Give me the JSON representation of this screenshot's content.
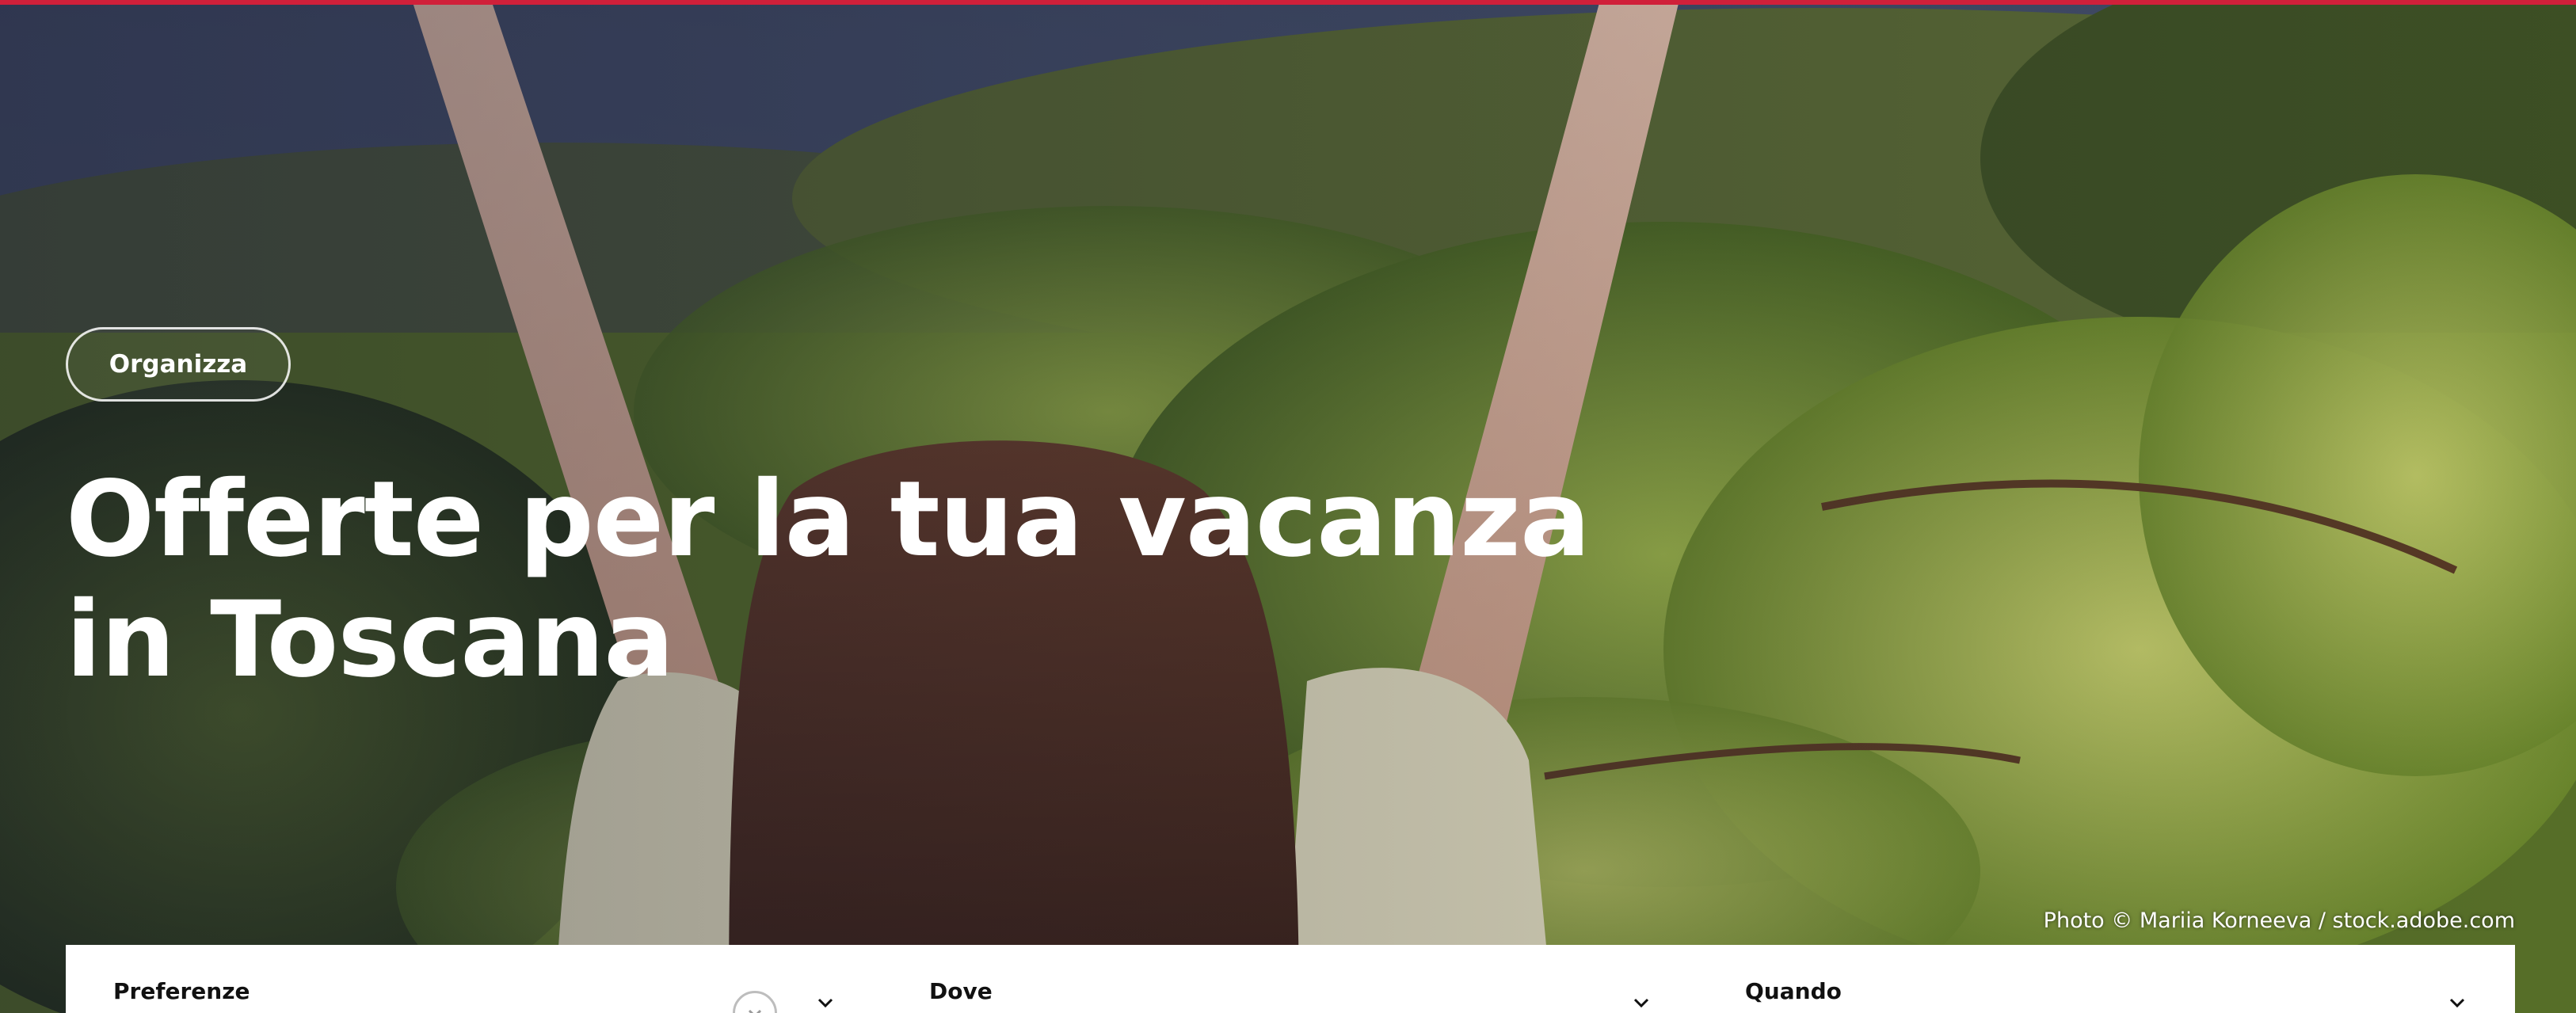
{
  "hero": {
    "tag_label": "Organizza",
    "title_line_1": "Offerte per la tua vacanza",
    "title_line_2": "in Toscana",
    "photo_credit": "Photo © Mariia Korneeva / stock.adobe.com",
    "accent_color": "#d0203a"
  },
  "search": {
    "fields": [
      {
        "label": "Preferenze",
        "icon": "chevron-down-icon"
      },
      {
        "label": "Dove",
        "icon": "chevron-down-icon"
      },
      {
        "label": "Quando",
        "icon": "chevron-down-icon"
      }
    ],
    "reset_icon": "reset-icon"
  }
}
